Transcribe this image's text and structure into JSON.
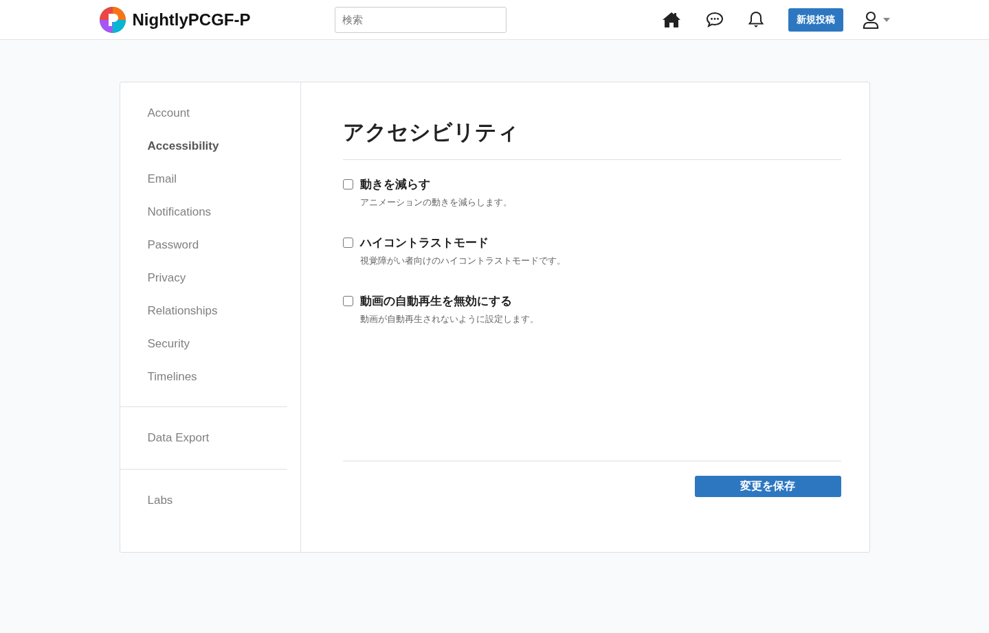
{
  "header": {
    "brand": "NightlyPCGF-P",
    "search": {
      "placeholder": "検索"
    },
    "new_post_button": "新規投稿"
  },
  "sidebar": {
    "groups": [
      {
        "items": [
          {
            "label": "Account",
            "selected": false
          },
          {
            "label": "Accessibility",
            "selected": true
          },
          {
            "label": "Email",
            "selected": false
          },
          {
            "label": "Notifications",
            "selected": false
          },
          {
            "label": "Password",
            "selected": false
          },
          {
            "label": "Privacy",
            "selected": false
          },
          {
            "label": "Relationships",
            "selected": false
          },
          {
            "label": "Security",
            "selected": false
          },
          {
            "label": "Timelines",
            "selected": false
          }
        ]
      },
      {
        "items": [
          {
            "label": "Data Export",
            "selected": false
          }
        ]
      },
      {
        "items": [
          {
            "label": "Labs",
            "selected": false
          }
        ]
      }
    ]
  },
  "content": {
    "title": "アクセシビリティ",
    "options": [
      {
        "label": "動きを減らす",
        "description": "アニメーションの動きを減らします。",
        "checked": false
      },
      {
        "label": "ハイコントラストモード",
        "description": "視覚障がい者向けのハイコントラストモードです。",
        "checked": false
      },
      {
        "label": "動画の自動再生を無効にする",
        "description": "動画が自動再生されないように設定します。",
        "checked": false
      }
    ],
    "save_button": "変更を保存"
  }
}
